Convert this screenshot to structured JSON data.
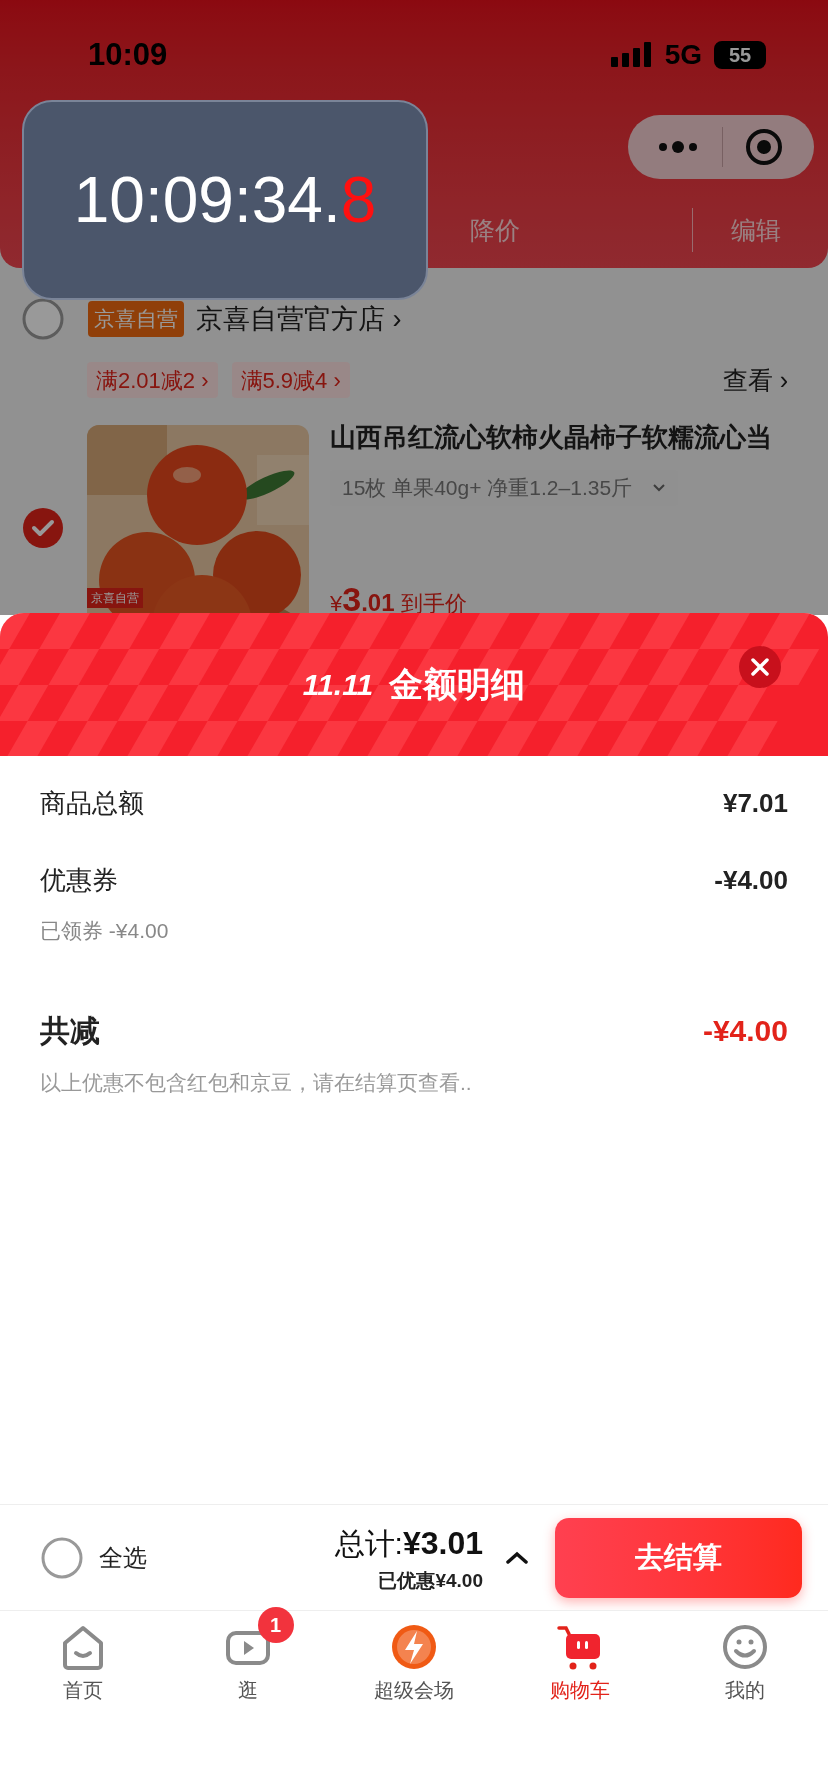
{
  "status_bar": {
    "time": "10:09",
    "network": "5G",
    "battery": "55"
  },
  "timer_overlay": {
    "main": "10:09:34.",
    "tenths": "8"
  },
  "header": {
    "filter_tab": "降价",
    "edit_button": "编辑"
  },
  "store": {
    "checked": false,
    "badge": "京喜自营",
    "name": "京喜自营官方店",
    "chevron": "›"
  },
  "promotions": [
    {
      "label": "满2.01减2",
      "chevron": "›"
    },
    {
      "label": "满5.9减4",
      "chevron": "›"
    }
  ],
  "view_link": {
    "label": "查看",
    "chevron": "›"
  },
  "product": {
    "checked": true,
    "title": "山西吊红流心软柿火晶柿子软糯流心当",
    "spec": "15枚 单果40g+ 净重1.2–1.35斤",
    "image_badge": "京喜自营",
    "price_symbol": "¥",
    "price_int": "3",
    "price_dec": ".01",
    "price_note": "到手价"
  },
  "sheet": {
    "logo": "11.11",
    "title": "金额明细",
    "rows": [
      {
        "kind": "line",
        "label": "商品总额",
        "value": "¥7.01"
      },
      {
        "kind": "line",
        "label": "优惠券",
        "value": "-¥4.00"
      },
      {
        "kind": "sub",
        "label": "已领券 -¥4.00"
      },
      {
        "kind": "total",
        "label": "共减",
        "value": "-¥4.00"
      },
      {
        "kind": "note",
        "label": "以上优惠不包含红包和京豆，请在结算页查看.."
      }
    ]
  },
  "checkout": {
    "select_all": {
      "checked": false,
      "label": "全选"
    },
    "total_label": "总计:",
    "total": "¥3.01",
    "saved": "已优惠¥4.00",
    "button": "去结算"
  },
  "tab_bar": [
    {
      "kind": "home",
      "label": "首页",
      "selected": false
    },
    {
      "kind": "video",
      "label": "逛",
      "selected": false,
      "badge": "1"
    },
    {
      "kind": "super",
      "label": "超级会场",
      "selected": false
    },
    {
      "kind": "cart",
      "label": "购物车",
      "selected": true
    },
    {
      "kind": "me",
      "label": "我的",
      "selected": false
    }
  ]
}
